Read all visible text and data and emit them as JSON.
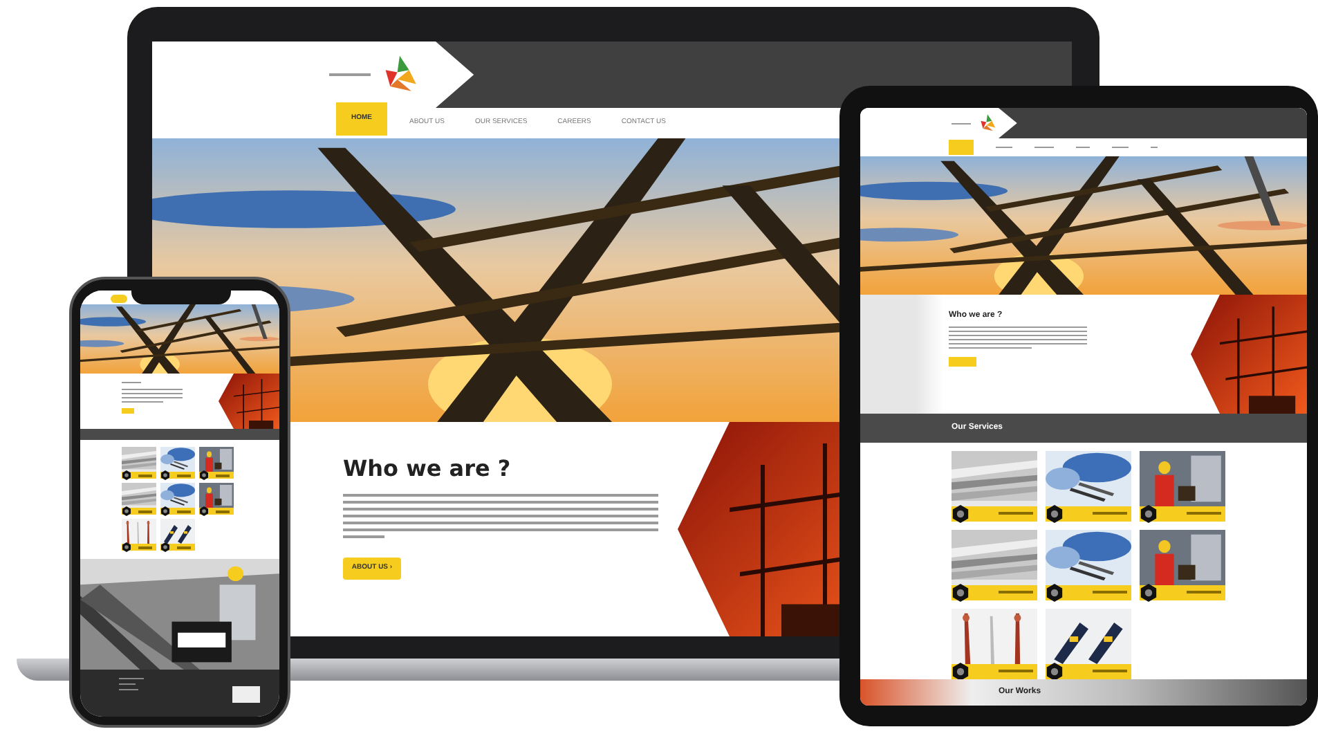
{
  "laptop": {
    "nav": [
      {
        "label": "HOME",
        "selected": true
      },
      {
        "label": "ABOUT US",
        "selected": false
      },
      {
        "label": "OUR SERVICES",
        "selected": false
      },
      {
        "label": "CAREERS",
        "selected": false
      },
      {
        "label": "CONTACT US",
        "selected": false
      }
    ],
    "about": {
      "title": "Who we are ?",
      "button": "ABOUT US ›"
    }
  },
  "tablet": {
    "about": {
      "title": "Who we are ?"
    },
    "services": {
      "title": "Our Services",
      "cards": [
        {
          "kind": "hall"
        },
        {
          "kind": "cables"
        },
        {
          "kind": "worker"
        },
        {
          "kind": "hall"
        },
        {
          "kind": "cables"
        },
        {
          "kind": "worker"
        },
        {
          "kind": "terminations"
        },
        {
          "kind": "connectors"
        }
      ]
    },
    "works": {
      "title": "Our Works"
    }
  },
  "phone": {
    "services": {
      "cards": [
        {
          "kind": "hall"
        },
        {
          "kind": "cables"
        },
        {
          "kind": "worker"
        },
        {
          "kind": "hall"
        },
        {
          "kind": "cables"
        },
        {
          "kind": "worker"
        },
        {
          "kind": "terminations"
        },
        {
          "kind": "connectors"
        }
      ]
    }
  }
}
